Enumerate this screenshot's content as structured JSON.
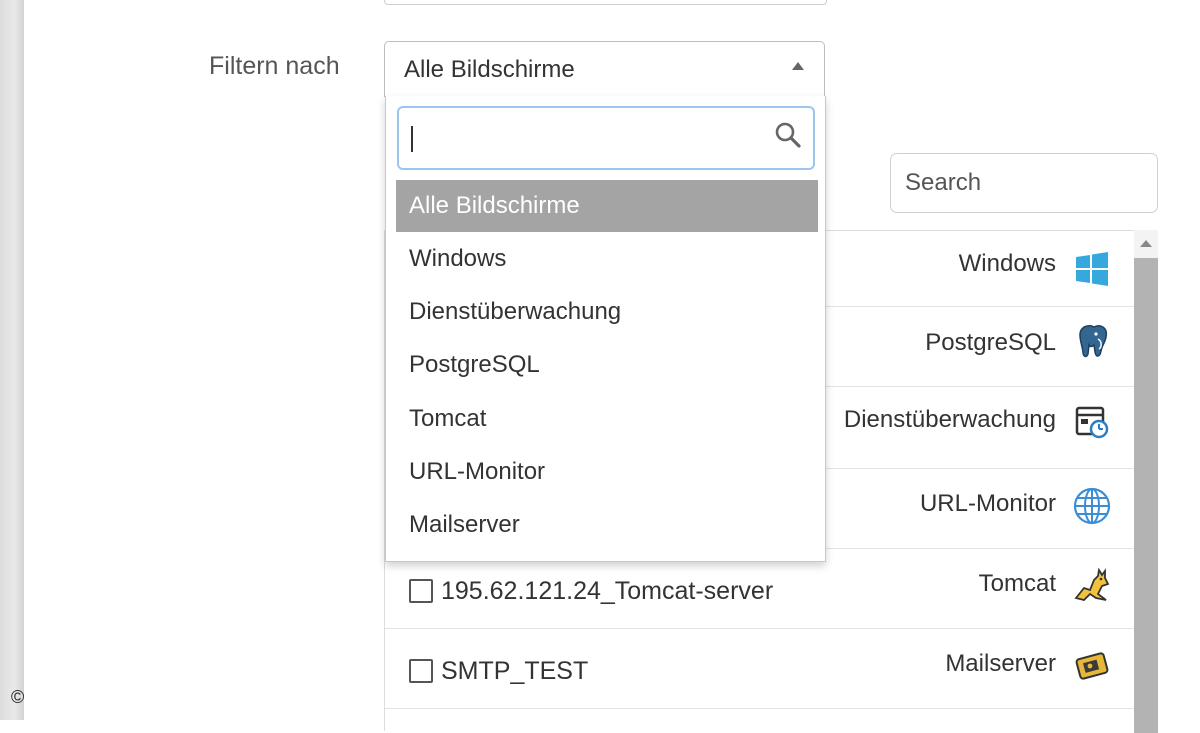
{
  "filter": {
    "label": "Filtern nach",
    "selected_value": "Alle Bildschirme",
    "search_value": "",
    "options": [
      "Alle Bildschirme",
      "Windows",
      "Dienstüberwachung",
      "PostgreSQL",
      "Tomcat",
      "URL-Monitor",
      "Mailserver"
    ]
  },
  "table_search": {
    "placeholder": "Search"
  },
  "rows": [
    {
      "name": "",
      "type": "Windows",
      "icon": "windows-icon"
    },
    {
      "name": "",
      "type": "PostgreSQL",
      "icon": "postgresql-elephant-icon"
    },
    {
      "name": "",
      "type": "Dienstüberwachung",
      "icon": "service-monitor-icon"
    },
    {
      "name": "",
      "type": "URL-Monitor",
      "icon": "globe-icon"
    },
    {
      "name": "195.62.121.24_Tomcat-server",
      "type": "Tomcat",
      "icon": "tomcat-cat-icon"
    },
    {
      "name": "SMTP_TEST",
      "type": "Mailserver",
      "icon": "mailserver-icon"
    }
  ],
  "copyright_symbol": "©",
  "colors": {
    "selected_option_bg": "#a4a4a4",
    "search_focus_border": "#9cc6ef",
    "windows_blue": "#35a8dd",
    "postgres_blue": "#336791"
  }
}
